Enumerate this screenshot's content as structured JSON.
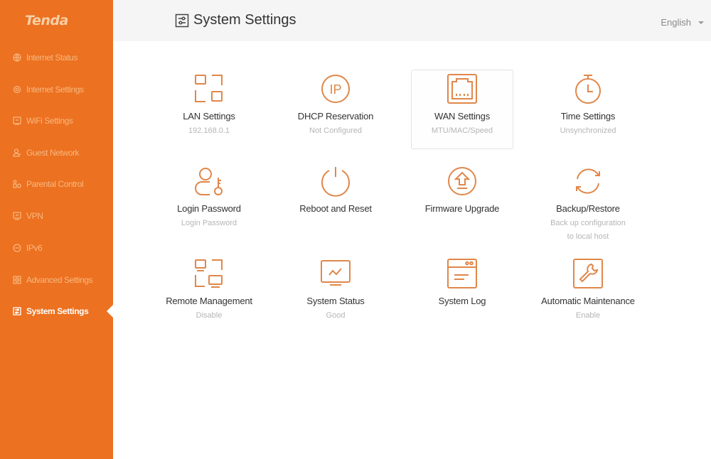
{
  "brand": {
    "logo_text": "Tenda",
    "accent_color": "#ec7120"
  },
  "sidebar": {
    "items": [
      {
        "label": "Internet Status",
        "icon": "globe-icon",
        "active": false
      },
      {
        "label": "Internet Settings",
        "icon": "gear-icon",
        "active": false
      },
      {
        "label": "WiFi Settings",
        "icon": "wifi-icon",
        "active": false
      },
      {
        "label": "Guest Network",
        "icon": "guest-user-icon",
        "active": false
      },
      {
        "label": "Parental Control",
        "icon": "parental-control-icon",
        "active": false
      },
      {
        "label": "VPN",
        "icon": "vpn-icon",
        "active": false
      },
      {
        "label": "IPv6",
        "icon": "ipv6-icon",
        "active": false
      },
      {
        "label": "Advanced Settings",
        "icon": "grid-icon",
        "active": false
      },
      {
        "label": "System Settings",
        "icon": "sliders-icon",
        "active": true
      }
    ]
  },
  "header": {
    "title": "System Settings",
    "title_icon": "sliders-icon",
    "language": "English"
  },
  "tiles": [
    {
      "label": "LAN Settings",
      "sub": "192.168.0.1",
      "icon": "lan-icon"
    },
    {
      "label": "DHCP Reservation",
      "sub": "Not Configured",
      "icon": "ip-icon"
    },
    {
      "label": "WAN Settings",
      "sub": "MTU/MAC/Speed",
      "icon": "ethernet-port-icon"
    },
    {
      "label": "Time Settings",
      "sub": "Unsynchronized",
      "icon": "stopwatch-icon"
    },
    {
      "label": "Login Password",
      "sub": "Login Password",
      "icon": "user-key-icon"
    },
    {
      "label": "Reboot and Reset",
      "sub": "",
      "icon": "power-icon"
    },
    {
      "label": "Firmware Upgrade",
      "sub": "",
      "icon": "upgrade-arrow-icon"
    },
    {
      "label": "Backup/Restore",
      "sub": "Back up configuration to local host",
      "icon": "sync-icon"
    },
    {
      "label": "Remote Management",
      "sub": "Disable",
      "icon": "remote-monitors-icon"
    },
    {
      "label": "System Status",
      "sub": "Good",
      "icon": "monitor-chart-icon"
    },
    {
      "label": "System Log",
      "sub": "",
      "icon": "log-window-icon"
    },
    {
      "label": "Automatic Maintenance",
      "sub": "Enable",
      "icon": "wrench-icon"
    }
  ]
}
